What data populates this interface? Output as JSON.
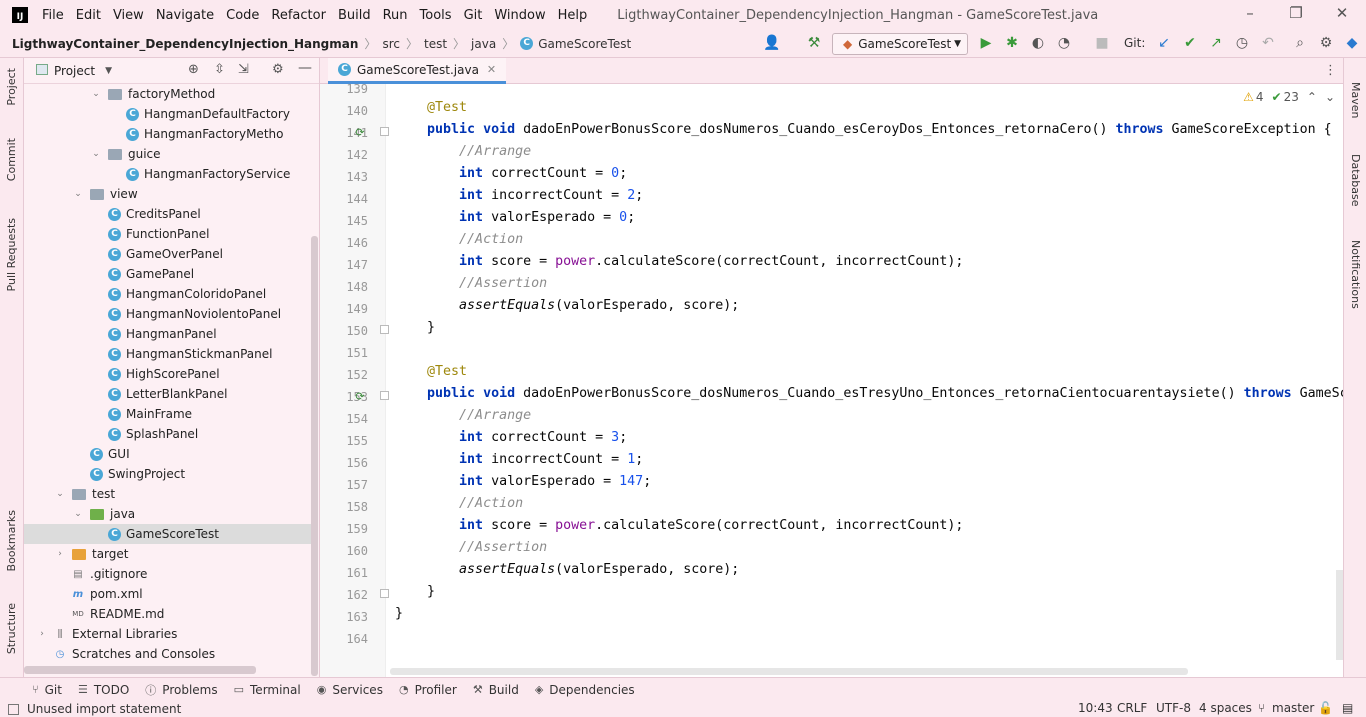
{
  "menubar": {
    "logo": "IJ",
    "items": [
      "File",
      "Edit",
      "View",
      "Navigate",
      "Code",
      "Refactor",
      "Build",
      "Run",
      "Tools",
      "Git",
      "Window",
      "Help"
    ],
    "window_title": "LigthwayContainer_DependencyInjection_Hangman - GameScoreTest.java"
  },
  "navbar": {
    "breadcrumbs": [
      "LigthwayContainer_DependencyInjection_Hangman",
      "src",
      "test",
      "java",
      "GameScoreTest"
    ],
    "run_config": "GameScoreTest",
    "git_label": "Git:"
  },
  "left_stripe": [
    "Project",
    "Commit",
    "Pull Requests",
    "Bookmarks",
    "Structure"
  ],
  "right_stripe": [
    "Maven",
    "Database",
    "Notifications"
  ],
  "project": {
    "title": "Project",
    "rows": [
      {
        "label": "factoryMethod",
        "type": "folder",
        "indent": 2,
        "arrow": "open"
      },
      {
        "label": "HangmanDefaultFactory",
        "type": "class",
        "indent": 3,
        "arrow": ""
      },
      {
        "label": "HangmanFactoryMetho",
        "type": "class",
        "indent": 3,
        "arrow": ""
      },
      {
        "label": "guice",
        "type": "folder",
        "indent": 2,
        "arrow": "open"
      },
      {
        "label": "HangmanFactoryService",
        "type": "class",
        "indent": 3,
        "arrow": ""
      },
      {
        "label": "view",
        "type": "folder",
        "indent": 1,
        "arrow": "open"
      },
      {
        "label": "CreditsPanel",
        "type": "class",
        "indent": 2,
        "arrow": ""
      },
      {
        "label": "FunctionPanel",
        "type": "class",
        "indent": 2,
        "arrow": ""
      },
      {
        "label": "GameOverPanel",
        "type": "class",
        "indent": 2,
        "arrow": ""
      },
      {
        "label": "GamePanel",
        "type": "class",
        "indent": 2,
        "arrow": ""
      },
      {
        "label": "HangmanColoridoPanel",
        "type": "class",
        "indent": 2,
        "arrow": ""
      },
      {
        "label": "HangmanNoviolentoPanel",
        "type": "class",
        "indent": 2,
        "arrow": ""
      },
      {
        "label": "HangmanPanel",
        "type": "class",
        "indent": 2,
        "arrow": ""
      },
      {
        "label": "HangmanStickmanPanel",
        "type": "class",
        "indent": 2,
        "arrow": ""
      },
      {
        "label": "HighScorePanel",
        "type": "class",
        "indent": 2,
        "arrow": ""
      },
      {
        "label": "LetterBlankPanel",
        "type": "class",
        "indent": 2,
        "arrow": ""
      },
      {
        "label": "MainFrame",
        "type": "class",
        "indent": 2,
        "arrow": ""
      },
      {
        "label": "SplashPanel",
        "type": "class",
        "indent": 2,
        "arrow": ""
      },
      {
        "label": "GUI",
        "type": "class",
        "indent": 1,
        "arrow": ""
      },
      {
        "label": "SwingProject",
        "type": "class",
        "indent": 1,
        "arrow": ""
      },
      {
        "label": "test",
        "type": "folder",
        "indent": 0,
        "arrow": "open"
      },
      {
        "label": "java",
        "type": "folder-green",
        "indent": 1,
        "arrow": "open"
      },
      {
        "label": "GameScoreTest",
        "type": "class",
        "indent": 2,
        "arrow": "",
        "selected": true
      },
      {
        "label": "target",
        "type": "folder-orange",
        "indent": 0,
        "arrow": "closed"
      },
      {
        "label": ".gitignore",
        "type": "file",
        "indent": 0,
        "arrow": ""
      },
      {
        "label": "pom.xml",
        "type": "file-m",
        "indent": 0,
        "arrow": ""
      },
      {
        "label": "README.md",
        "type": "file-md",
        "indent": 0,
        "arrow": ""
      },
      {
        "label": "External Libraries",
        "type": "lib",
        "indent": -1,
        "arrow": "closed"
      },
      {
        "label": "Scratches and Consoles",
        "type": "scratch",
        "indent": -1,
        "arrow": ""
      }
    ]
  },
  "editor": {
    "tab": "GameScoreTest.java",
    "warnings": "4",
    "ok_count": "23",
    "line_numbers": [
      "139",
      "140",
      "141",
      "142",
      "143",
      "144",
      "145",
      "146",
      "147",
      "148",
      "149",
      "150",
      "151",
      "152",
      "153",
      "154",
      "155",
      "156",
      "157",
      "158",
      "159",
      "160",
      "161",
      "162",
      "163",
      "164"
    ]
  },
  "bottom_tools": [
    "Git",
    "TODO",
    "Problems",
    "Terminal",
    "Services",
    "Profiler",
    "Build",
    "Dependencies"
  ],
  "status": {
    "message": "Unused import statement",
    "position": "10:43",
    "line_sep": "CRLF",
    "encoding": "UTF-8",
    "indent": "4 spaces",
    "branch": "master"
  }
}
